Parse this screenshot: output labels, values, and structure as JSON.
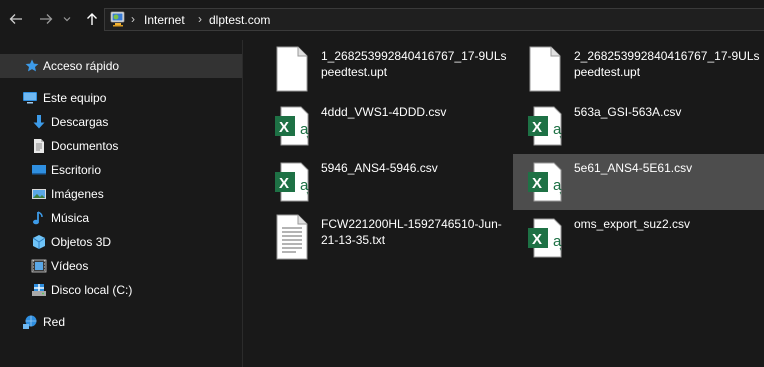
{
  "nav": {
    "back_icon": "back-arrow-icon",
    "forward_icon": "forward-arrow-icon",
    "recent_icon": "chevron-down-icon",
    "up_icon": "up-arrow-icon"
  },
  "address": {
    "icon": "network-location-icon",
    "crumbs": [
      "Internet",
      "dlptest.com"
    ]
  },
  "sidebar": {
    "items": [
      {
        "label": "Acceso rápido",
        "icon": "star-icon"
      },
      {
        "label": "Este equipo",
        "icon": "computer-icon"
      },
      {
        "label": "Descargas",
        "icon": "download-icon"
      },
      {
        "label": "Documentos",
        "icon": "documents-icon"
      },
      {
        "label": "Escritorio",
        "icon": "desktop-icon"
      },
      {
        "label": "Imágenes",
        "icon": "images-icon"
      },
      {
        "label": "Música",
        "icon": "music-icon"
      },
      {
        "label": "Objetos 3D",
        "icon": "cube-icon"
      },
      {
        "label": "Vídeos",
        "icon": "video-icon"
      },
      {
        "label": "Disco local (C:)",
        "icon": "drive-icon"
      },
      {
        "label": "Red",
        "icon": "network-icon"
      }
    ]
  },
  "files": [
    {
      "name": "1_268253992840416767_17-9ULspeedtest.upt",
      "type": "blank-file-icon"
    },
    {
      "name": "2_268253992840416767_17-9ULspeedtest.upt",
      "type": "blank-file-icon"
    },
    {
      "name": "4ddd_VWS1-4DDD.csv",
      "type": "excel-csv-icon"
    },
    {
      "name": "563a_GSI-563A.csv",
      "type": "excel-csv-icon"
    },
    {
      "name": "5946_ANS4-5946.csv",
      "type": "excel-csv-icon"
    },
    {
      "name": "5e61_ANS4-5E61.csv",
      "type": "excel-csv-icon"
    },
    {
      "name": "FCW221200HL-1592746510-Jun-21-13-35.txt",
      "type": "text-file-icon"
    },
    {
      "name": "oms_export_suz2.csv",
      "type": "excel-csv-icon"
    }
  ],
  "colors": {
    "background": "#191919",
    "selected": "#4d4d4d",
    "excel_green": "#1e7145",
    "accent_blue": "#2f8fe0"
  }
}
